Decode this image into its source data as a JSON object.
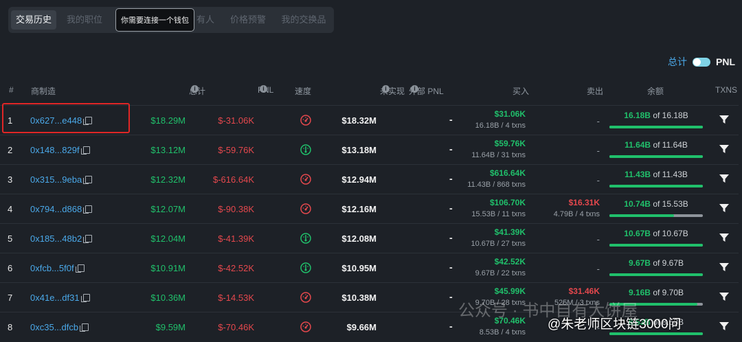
{
  "tabs": [
    {
      "label": "交易历史",
      "active": true
    },
    {
      "label": "我的职位",
      "active": false
    },
    {
      "label": "有人",
      "active": false
    },
    {
      "label": "价格预警",
      "active": false
    },
    {
      "label": "我的交换品",
      "active": false
    }
  ],
  "tooltip": "你需要连接一个钱包",
  "toggle": {
    "total_label": "总计",
    "pnl_label": "PNL",
    "on": true
  },
  "columns": {
    "rank": "#",
    "maker": "商制造",
    "total": "总计",
    "pnl": "PNL",
    "speed": "速度",
    "unrealized": "未实现",
    "external_pnl": "外部 PNL",
    "bought": "买入",
    "sold": "卖出",
    "balance": "余额",
    "txns": "TXNS"
  },
  "rows": [
    {
      "rank": "1",
      "address": "0x627...e448",
      "total": "$18.29M",
      "pnl": "$-31.06K",
      "speed": "red",
      "unrealized": "$18.32M",
      "external": "-",
      "buy_value": "$31.06K",
      "buy_sub": "16.18B / 4 txns",
      "sell_value": "",
      "sell_sub": "",
      "sell_dash": "-",
      "bal_amount": "16.18B",
      "bal_total": "of 16.18B",
      "bal_fraction": 1.0
    },
    {
      "rank": "2",
      "address": "0x148...829f",
      "total": "$13.12M",
      "pnl": "$-59.76K",
      "speed": "green",
      "unrealized": "$13.18M",
      "external": "-",
      "buy_value": "$59.76K",
      "buy_sub": "11.64B / 31 txns",
      "sell_value": "",
      "sell_sub": "",
      "sell_dash": "-",
      "bal_amount": "11.64B",
      "bal_total": "of 11.64B",
      "bal_fraction": 1.0
    },
    {
      "rank": "3",
      "address": "0x315...9eba",
      "total": "$12.32M",
      "pnl": "$-616.64K",
      "speed": "red",
      "unrealized": "$12.94M",
      "external": "-",
      "buy_value": "$616.64K",
      "buy_sub": "11.43B / 868 txns",
      "sell_value": "",
      "sell_sub": "",
      "sell_dash": "-",
      "bal_amount": "11.43B",
      "bal_total": "of 11.43B",
      "bal_fraction": 1.0
    },
    {
      "rank": "4",
      "address": "0x794...d868",
      "total": "$12.07M",
      "pnl": "$-90.38K",
      "speed": "red",
      "unrealized": "$12.16M",
      "external": "-",
      "buy_value": "$106.70K",
      "buy_sub": "15.53B / 11 txns",
      "sell_value": "$16.31K",
      "sell_sub": "4.79B / 4 txns",
      "sell_dash": "",
      "bal_amount": "10.74B",
      "bal_total": "of 15.53B",
      "bal_fraction": 0.6916
    },
    {
      "rank": "5",
      "address": "0x185...48b2",
      "total": "$12.04M",
      "pnl": "$-41.39K",
      "speed": "green",
      "unrealized": "$12.08M",
      "external": "-",
      "buy_value": "$41.39K",
      "buy_sub": "10.67B / 27 txns",
      "sell_value": "",
      "sell_sub": "",
      "sell_dash": "-",
      "bal_amount": "10.67B",
      "bal_total": "of 10.67B",
      "bal_fraction": 1.0
    },
    {
      "rank": "6",
      "address": "0xfcb...5f0f",
      "total": "$10.91M",
      "pnl": "$-42.52K",
      "speed": "green",
      "unrealized": "$10.95M",
      "external": "-",
      "buy_value": "$42.52K",
      "buy_sub": "9.67B / 22 txns",
      "sell_value": "",
      "sell_sub": "",
      "sell_dash": "-",
      "bal_amount": "9.67B",
      "bal_total": "of 9.67B",
      "bal_fraction": 1.0
    },
    {
      "rank": "7",
      "address": "0x41e...df31",
      "total": "$10.36M",
      "pnl": "$-14.53K",
      "speed": "red",
      "unrealized": "$10.38M",
      "external": "-",
      "buy_value": "$45.99K",
      "buy_sub": "9.70B / 28 txns",
      "sell_value": "$31.46K",
      "sell_sub": "525M / 3 txns",
      "sell_dash": "",
      "bal_amount": "9.16B",
      "bal_total": "of 9.70B",
      "bal_fraction": 0.9443
    },
    {
      "rank": "8",
      "address": "0xc35...dfcb",
      "total": "$9.59M",
      "pnl": "$-70.46K",
      "speed": "red",
      "unrealized": "$9.66M",
      "external": "-",
      "buy_value": "$70.46K",
      "buy_sub": "8.53B / 4 txns",
      "sell_value": "",
      "sell_sub": "",
      "sell_dash": "-",
      "bal_amount": "8.53B",
      "bal_total": "of 8.53B",
      "bal_fraction": 1.0
    }
  ],
  "watermark": {
    "line1": "公众号 · 书中自有大饼屋",
    "line2": "@朱老师区块链3000问"
  },
  "colors": {
    "green": "#20c06b",
    "red": "#e5484d",
    "link": "#4aa8e8",
    "highlight": "#e02626"
  }
}
